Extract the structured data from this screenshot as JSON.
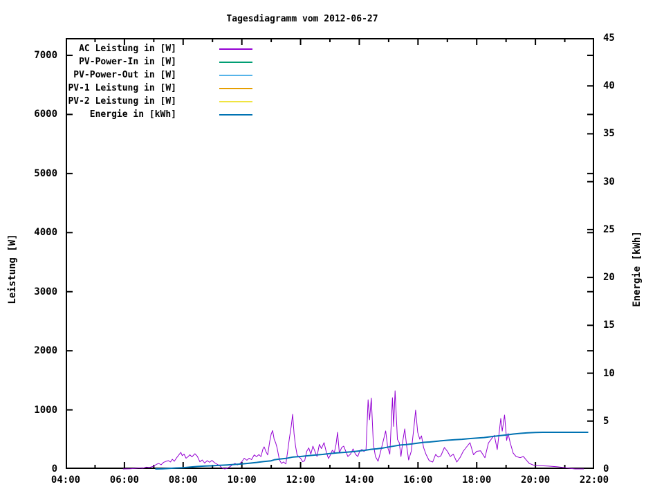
{
  "chart_data": {
    "type": "line",
    "title": "Tagesdiagramm vom 2012-06-27",
    "grid": false,
    "legend_position": "top-left-inside",
    "x_axis": {
      "tick_labels": [
        "04:00",
        "06:00",
        "08:00",
        "10:00",
        "12:00",
        "14:00",
        "16:00",
        "18:00",
        "20:00",
        "22:00"
      ],
      "major_tick_hours": [
        4,
        6,
        8,
        10,
        12,
        14,
        16,
        18,
        20,
        22
      ],
      "minor_tick_hours": [
        5,
        7,
        9,
        11,
        13,
        15,
        17,
        19,
        21
      ],
      "range_hours": [
        4,
        22
      ]
    },
    "y_left": {
      "label": "Leistung [W]",
      "ticks": [
        0,
        1000,
        2000,
        3000,
        4000,
        5000,
        6000,
        7000
      ],
      "max": 7293
    },
    "y_right": {
      "label": "Energie [kWh]",
      "ticks": [
        0,
        5,
        10,
        15,
        20,
        25,
        30,
        35,
        40,
        45
      ],
      "max": 45
    },
    "series": [
      {
        "name": "AC Leistung in [W]",
        "color": "#9400d3",
        "axis": "left",
        "stroke_width": 1,
        "points": [
          [
            5.95,
            0
          ],
          [
            6.2,
            3
          ],
          [
            6.35,
            8
          ],
          [
            6.5,
            18
          ],
          [
            6.62,
            12
          ],
          [
            6.75,
            30
          ],
          [
            6.85,
            24
          ],
          [
            6.95,
            40
          ],
          [
            7.0,
            47
          ],
          [
            7.08,
            75
          ],
          [
            7.17,
            94
          ],
          [
            7.25,
            70
          ],
          [
            7.33,
            110
          ],
          [
            7.42,
            130
          ],
          [
            7.5,
            141
          ],
          [
            7.57,
            118
          ],
          [
            7.63,
            164
          ],
          [
            7.7,
            130
          ],
          [
            7.78,
            190
          ],
          [
            7.85,
            235
          ],
          [
            7.92,
            281
          ],
          [
            7.97,
            225
          ],
          [
            8.03,
            252
          ],
          [
            8.1,
            182
          ],
          [
            8.17,
            210
          ],
          [
            8.23,
            240
          ],
          [
            8.3,
            205
          ],
          [
            8.4,
            258
          ],
          [
            8.48,
            215
          ],
          [
            8.57,
            120
          ],
          [
            8.65,
            152
          ],
          [
            8.73,
            100
          ],
          [
            8.82,
            141
          ],
          [
            8.9,
            112
          ],
          [
            8.98,
            145
          ],
          [
            9.07,
            105
          ],
          [
            9.15,
            82
          ],
          [
            9.23,
            60
          ],
          [
            9.33,
            15
          ],
          [
            9.42,
            0
          ],
          [
            9.5,
            12
          ],
          [
            9.6,
            40
          ],
          [
            9.68,
            70
          ],
          [
            9.77,
            94
          ],
          [
            9.85,
            68
          ],
          [
            9.93,
            90
          ],
          [
            10.0,
            123
          ],
          [
            10.08,
            182
          ],
          [
            10.17,
            148
          ],
          [
            10.25,
            182
          ],
          [
            10.33,
            158
          ],
          [
            10.42,
            238
          ],
          [
            10.5,
            208
          ],
          [
            10.58,
            242
          ],
          [
            10.65,
            210
          ],
          [
            10.72,
            340
          ],
          [
            10.76,
            375
          ],
          [
            10.82,
            295
          ],
          [
            10.88,
            238
          ],
          [
            10.95,
            470
          ],
          [
            11.0,
            591
          ],
          [
            11.05,
            650
          ],
          [
            11.1,
            500
          ],
          [
            11.15,
            445
          ],
          [
            11.2,
            357
          ],
          [
            11.28,
            152
          ],
          [
            11.35,
            94
          ],
          [
            11.42,
            118
          ],
          [
            11.5,
            85
          ],
          [
            11.56,
            300
          ],
          [
            11.62,
            520
          ],
          [
            11.68,
            720
          ],
          [
            11.73,
            925
          ],
          [
            11.78,
            590
          ],
          [
            11.83,
            386
          ],
          [
            11.88,
            240
          ],
          [
            11.95,
            200
          ],
          [
            12.0,
            182
          ],
          [
            12.07,
            123
          ],
          [
            12.14,
            140
          ],
          [
            12.21,
            299
          ],
          [
            12.28,
            357
          ],
          [
            12.35,
            250
          ],
          [
            12.42,
            386
          ],
          [
            12.49,
            295
          ],
          [
            12.56,
            211
          ],
          [
            12.64,
            416
          ],
          [
            12.71,
            345
          ],
          [
            12.8,
            445
          ],
          [
            12.88,
            280
          ],
          [
            12.95,
            176
          ],
          [
            13.02,
            240
          ],
          [
            13.08,
            316
          ],
          [
            13.15,
            278
          ],
          [
            13.21,
            420
          ],
          [
            13.26,
            620
          ],
          [
            13.32,
            270
          ],
          [
            13.4,
            363
          ],
          [
            13.47,
            386
          ],
          [
            13.54,
            300
          ],
          [
            13.61,
            211
          ],
          [
            13.7,
            250
          ],
          [
            13.79,
            340
          ],
          [
            13.87,
            248
          ],
          [
            13.95,
            211
          ],
          [
            14.02,
            308
          ],
          [
            14.09,
            330
          ],
          [
            14.16,
            295
          ],
          [
            14.23,
            330
          ],
          [
            14.3,
            1171
          ],
          [
            14.35,
            832
          ],
          [
            14.41,
            1200
          ],
          [
            14.48,
            420
          ],
          [
            14.55,
            211
          ],
          [
            14.64,
            130
          ],
          [
            14.73,
            300
          ],
          [
            14.82,
            480
          ],
          [
            14.9,
            644
          ],
          [
            14.97,
            363
          ],
          [
            15.04,
            250
          ],
          [
            15.13,
            1206
          ],
          [
            15.17,
            720
          ],
          [
            15.22,
            1323
          ],
          [
            15.3,
            500
          ],
          [
            15.36,
            445
          ],
          [
            15.42,
            211
          ],
          [
            15.49,
            500
          ],
          [
            15.55,
            679
          ],
          [
            15.61,
            400
          ],
          [
            15.68,
            152
          ],
          [
            15.77,
            300
          ],
          [
            15.86,
            700
          ],
          [
            15.92,
            995
          ],
          [
            15.99,
            620
          ],
          [
            16.06,
            503
          ],
          [
            16.12,
            560
          ],
          [
            16.19,
            363
          ],
          [
            16.27,
            250
          ],
          [
            16.38,
            140
          ],
          [
            16.5,
            117
          ],
          [
            16.6,
            246
          ],
          [
            16.69,
            200
          ],
          [
            16.78,
            222
          ],
          [
            16.9,
            363
          ],
          [
            17.0,
            300
          ],
          [
            17.1,
            211
          ],
          [
            17.2,
            250
          ],
          [
            17.32,
            117
          ],
          [
            17.44,
            200
          ],
          [
            17.54,
            299
          ],
          [
            17.64,
            363
          ],
          [
            17.77,
            445
          ],
          [
            17.89,
            240
          ],
          [
            18.0,
            299
          ],
          [
            18.13,
            308
          ],
          [
            18.28,
            191
          ],
          [
            18.4,
            440
          ],
          [
            18.53,
            527
          ],
          [
            18.6,
            569
          ],
          [
            18.7,
            328
          ],
          [
            18.82,
            855
          ],
          [
            18.87,
            640
          ],
          [
            18.95,
            913
          ],
          [
            19.02,
            484
          ],
          [
            19.07,
            601
          ],
          [
            19.14,
            445
          ],
          [
            19.24,
            269
          ],
          [
            19.34,
            211
          ],
          [
            19.48,
            191
          ],
          [
            19.59,
            211
          ],
          [
            19.69,
            150
          ],
          [
            19.79,
            94
          ],
          [
            19.95,
            62
          ],
          [
            20.15,
            56
          ],
          [
            20.45,
            48
          ],
          [
            20.75,
            36
          ],
          [
            21.0,
            22
          ],
          [
            21.2,
            8
          ],
          [
            21.35,
            0
          ],
          [
            21.65,
            0
          ]
        ]
      },
      {
        "name": "PV-Power-In in [W]",
        "color": "#009e73",
        "axis": "left",
        "stroke_width": 1,
        "points": []
      },
      {
        "name": "PV-Power-Out in [W]",
        "color": "#56b4e9",
        "axis": "left",
        "stroke_width": 1,
        "points": []
      },
      {
        "name": "PV-1 Leistung in [W]",
        "color": "#e69f00",
        "axis": "left",
        "stroke_width": 1,
        "points": []
      },
      {
        "name": "PV-2 Leistung in [W]",
        "color": "#f0e442",
        "axis": "left",
        "stroke_width": 1,
        "points": []
      },
      {
        "name": "Energie in [kWh]",
        "color": "#0072b2",
        "axis": "right",
        "stroke_width": 2,
        "points": [
          [
            7.05,
            0
          ],
          [
            7.3,
            0.02
          ],
          [
            7.5,
            0.06
          ],
          [
            7.75,
            0.1
          ],
          [
            8.0,
            0.13
          ],
          [
            8.25,
            0.2
          ],
          [
            8.5,
            0.26
          ],
          [
            8.75,
            0.3
          ],
          [
            9.0,
            0.33
          ],
          [
            9.25,
            0.38
          ],
          [
            9.5,
            0.42
          ],
          [
            9.75,
            0.47
          ],
          [
            10.0,
            0.52
          ],
          [
            10.25,
            0.6
          ],
          [
            10.5,
            0.68
          ],
          [
            10.75,
            0.78
          ],
          [
            11.0,
            0.85
          ],
          [
            11.1,
            0.95
          ],
          [
            11.25,
            1.02
          ],
          [
            11.5,
            1.1
          ],
          [
            11.75,
            1.25
          ],
          [
            12.0,
            1.3
          ],
          [
            12.25,
            1.38
          ],
          [
            12.5,
            1.45
          ],
          [
            12.75,
            1.52
          ],
          [
            13.0,
            1.6
          ],
          [
            13.25,
            1.68
          ],
          [
            13.5,
            1.73
          ],
          [
            13.75,
            1.8
          ],
          [
            14.0,
            1.88
          ],
          [
            14.2,
            1.95
          ],
          [
            14.4,
            2.05
          ],
          [
            14.6,
            2.1
          ],
          [
            14.8,
            2.18
          ],
          [
            15.0,
            2.3
          ],
          [
            15.2,
            2.4
          ],
          [
            15.4,
            2.5
          ],
          [
            15.6,
            2.55
          ],
          [
            15.8,
            2.62
          ],
          [
            16.0,
            2.7
          ],
          [
            16.2,
            2.78
          ],
          [
            16.4,
            2.82
          ],
          [
            16.6,
            2.88
          ],
          [
            16.8,
            2.95
          ],
          [
            17.0,
            3.0
          ],
          [
            17.25,
            3.05
          ],
          [
            17.5,
            3.1
          ],
          [
            17.75,
            3.17
          ],
          [
            18.0,
            3.22
          ],
          [
            18.25,
            3.28
          ],
          [
            18.5,
            3.38
          ],
          [
            18.75,
            3.47
          ],
          [
            19.0,
            3.55
          ],
          [
            19.25,
            3.65
          ],
          [
            19.5,
            3.72
          ],
          [
            19.75,
            3.78
          ],
          [
            20.0,
            3.81
          ],
          [
            20.25,
            3.83
          ],
          [
            20.75,
            3.83
          ],
          [
            21.5,
            3.83
          ],
          [
            21.8,
            3.83
          ]
        ]
      }
    ],
    "colors": {
      "background": "#ffffff",
      "axis": "#000000"
    }
  }
}
